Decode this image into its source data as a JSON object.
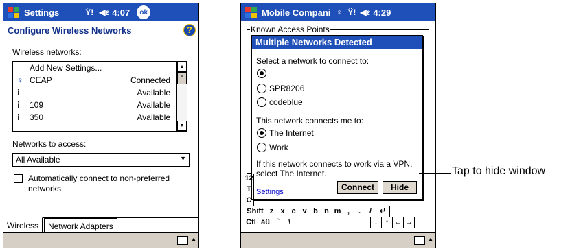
{
  "left": {
    "title": "Settings",
    "time": "4:07",
    "ok_label": "ok",
    "header": "Configure Wireless Networks",
    "wireless_networks_label": "Wireless networks:",
    "networks": [
      {
        "name": "Add New Settings...",
        "status": ""
      },
      {
        "name": "CEAP",
        "status": "Connected"
      },
      {
        "name": "",
        "status": "Available"
      },
      {
        "name": "109",
        "status": "Available"
      },
      {
        "name": "350",
        "status": "Available"
      }
    ],
    "networks_to_access_label": "Networks to access:",
    "networks_to_access_value": "All Available",
    "auto_connect_label": "Automatically connect to non-preferred networks",
    "tabs": [
      "Wireless",
      "Network Adapters"
    ]
  },
  "right": {
    "title": "Mobile Compani",
    "time": "4:29",
    "frame_label": "Known Access Points",
    "dialog_title": "Multiple Networks Detected",
    "select_prompt": "Select a network to connect to:",
    "network_options": [
      "",
      "SPR8206",
      "codeblue"
    ],
    "connects_prompt": "This network connects me to:",
    "connect_options": [
      "The Internet",
      "Work"
    ],
    "vpn_text": "If this network connects to work via a VPN, select The Internet.",
    "settings_link": "Settings",
    "connect_button": "Connect",
    "hide_button": "Hide",
    "keyboard_rows": [
      [
        "12"
      ],
      [
        "T"
      ],
      [
        "C"
      ],
      [
        "Shift",
        "z",
        "x",
        "c",
        "v",
        "b",
        "n",
        "m",
        ",",
        ".",
        "/",
        "↵"
      ],
      [
        "Ctl",
        "áü",
        "`",
        "\\",
        "",
        "↓",
        "↑",
        "←",
        "→"
      ]
    ]
  },
  "callout": "Tap to hide window"
}
